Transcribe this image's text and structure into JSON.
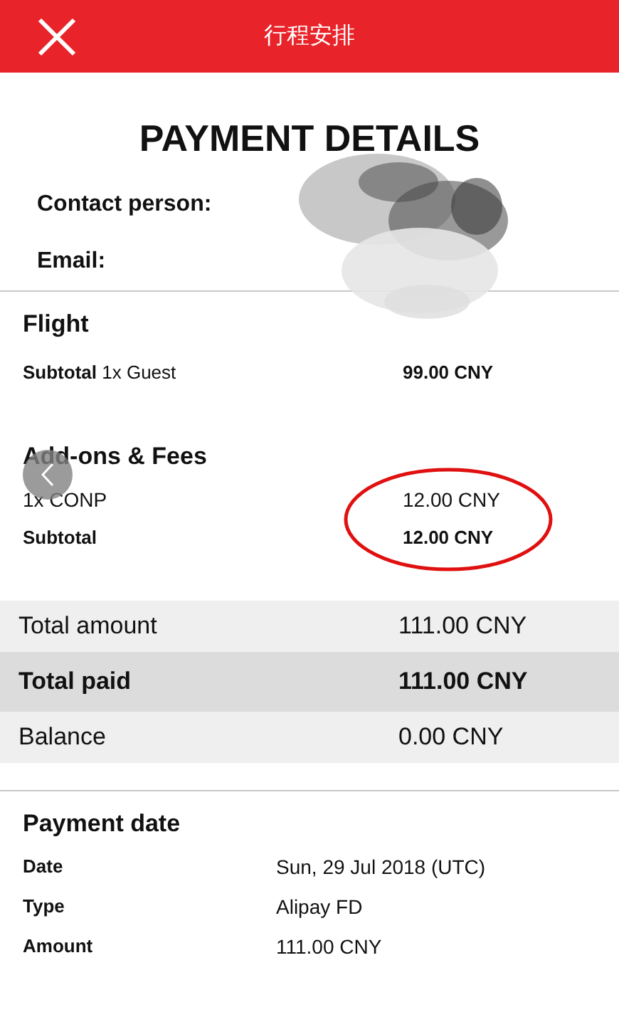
{
  "header": {
    "title": "行程安排"
  },
  "page_title": "PAYMENT DETAILS",
  "contact_fields": [
    {
      "label": "Contact person:"
    },
    {
      "label": "Email:"
    }
  ],
  "sections": [
    {
      "heading": "Flight",
      "rows": [
        {
          "kind": "subtotal",
          "label": "Subtotal",
          "note": "1x Guest",
          "value": "99.00 CNY"
        }
      ]
    },
    {
      "heading": "Add-ons & Fees",
      "rows": [
        {
          "kind": "item",
          "label": "1x CONP",
          "value": "12.00 CNY"
        },
        {
          "kind": "subtotal",
          "label": "Subtotal",
          "value": "12.00 CNY"
        }
      ]
    }
  ],
  "totals": [
    {
      "kind": "plain",
      "label": "Total amount",
      "value": "111.00 CNY"
    },
    {
      "kind": "strong",
      "label": "Total paid",
      "value": "111.00 CNY"
    },
    {
      "kind": "plain",
      "label": "Balance",
      "value": "0.00 CNY"
    }
  ],
  "payment": {
    "heading": "Payment date",
    "rows": [
      {
        "label": "Date",
        "value": "Sun, 29 Jul 2018 (UTC)"
      },
      {
        "label": "Type",
        "value": "Alipay FD"
      },
      {
        "label": "Amount",
        "value": "111.00 CNY"
      }
    ]
  }
}
